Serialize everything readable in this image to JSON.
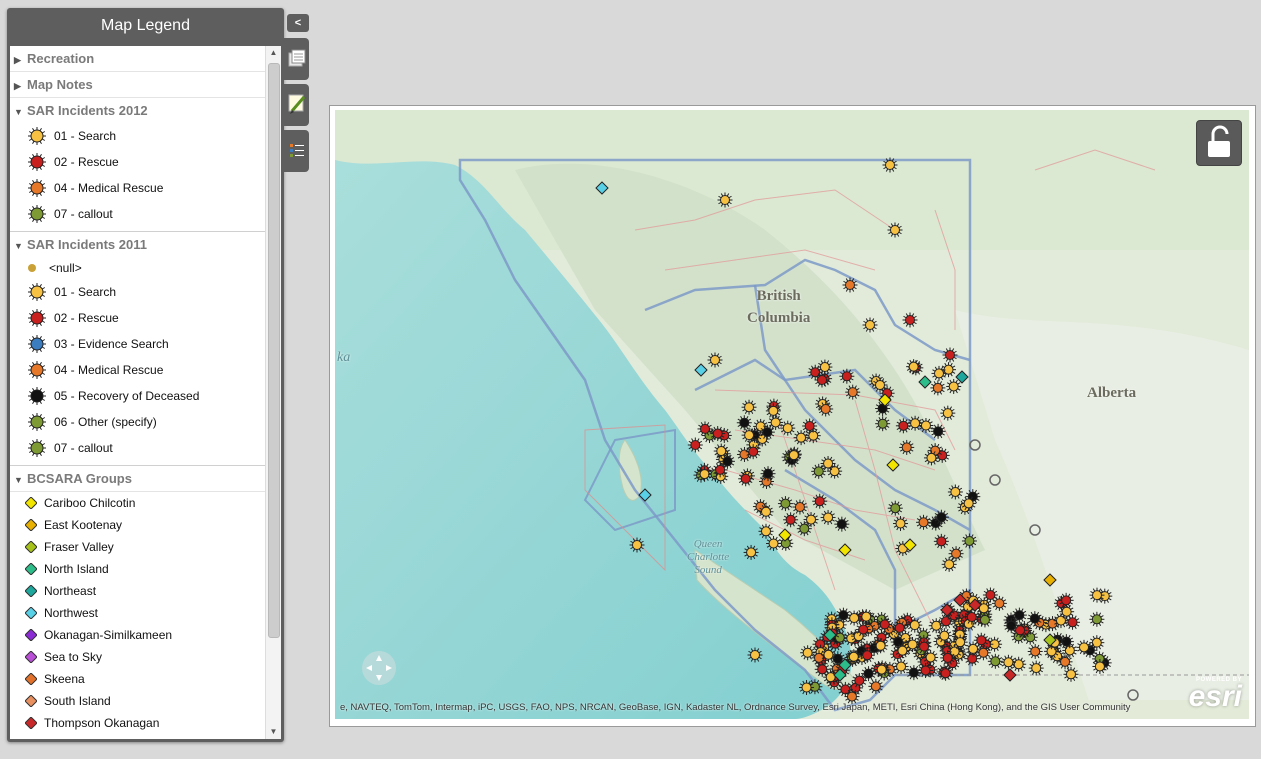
{
  "legend": {
    "title": "Map Legend",
    "sections": {
      "recreation": {
        "label": "Recreation"
      },
      "map_notes": {
        "label": "Map Notes"
      },
      "sar2012": {
        "label": "SAR Incidents 2012",
        "items": [
          "01 - Search",
          "02 - Rescue",
          "04 - Medical Rescue",
          "07 - callout"
        ]
      },
      "sar2011": {
        "label": "SAR Incidents 2011",
        "items": [
          "<null>",
          "01 - Search",
          "02 - Rescue",
          "03 - Evidence Search",
          "04 - Medical Rescue",
          "05 - Recovery of Deceased",
          "06 - Other (specify)",
          "07 - callout"
        ]
      },
      "groups": {
        "label": "BCSARA Groups",
        "items": [
          "Cariboo Chilcotin",
          "East Kootenay",
          "Fraser Valley",
          "North Island",
          "Northeast",
          "Northwest",
          "Okanagan-Similkameen",
          "Sea to Sky",
          "Skeena",
          "South Island",
          "Thompson Okanagan"
        ]
      }
    }
  },
  "colors": {
    "search": "#f7c143",
    "rescue": "#c8201e",
    "evidence": "#3c7dbf",
    "medical": "#e6782a",
    "recovery": "#111111",
    "other": "#7e9a34",
    "callout": "#7e9a34",
    "null": "#c9a136",
    "groups": [
      "#f2e600",
      "#e8b000",
      "#a8c21c",
      "#2dbd8a",
      "#1ea79c",
      "#5ad0e6",
      "#8b2bd6",
      "#b84fd6",
      "#e2722b",
      "#e89060",
      "#c82828"
    ]
  },
  "map": {
    "labels": {
      "bc": "British\nColumbia",
      "alberta": "Alberta",
      "qc_sound": "Queen\nCharlotte\nSound",
      "alaska": "ka"
    },
    "attribution": "e, NAVTEQ, TomTom, Intermap, iPC, USGS, FAO, NPS, NRCAN, GeoBase, IGN, Kadaster NL, Ordnance Survey, Esri Japan, METI, Esri China (Hong Kong), and the GIS User Community",
    "esri_powered": "POWERED BY",
    "esri_word": "esri",
    "lock_icon": "unlock-icon",
    "nav_icon": "pan-compass-icon"
  }
}
